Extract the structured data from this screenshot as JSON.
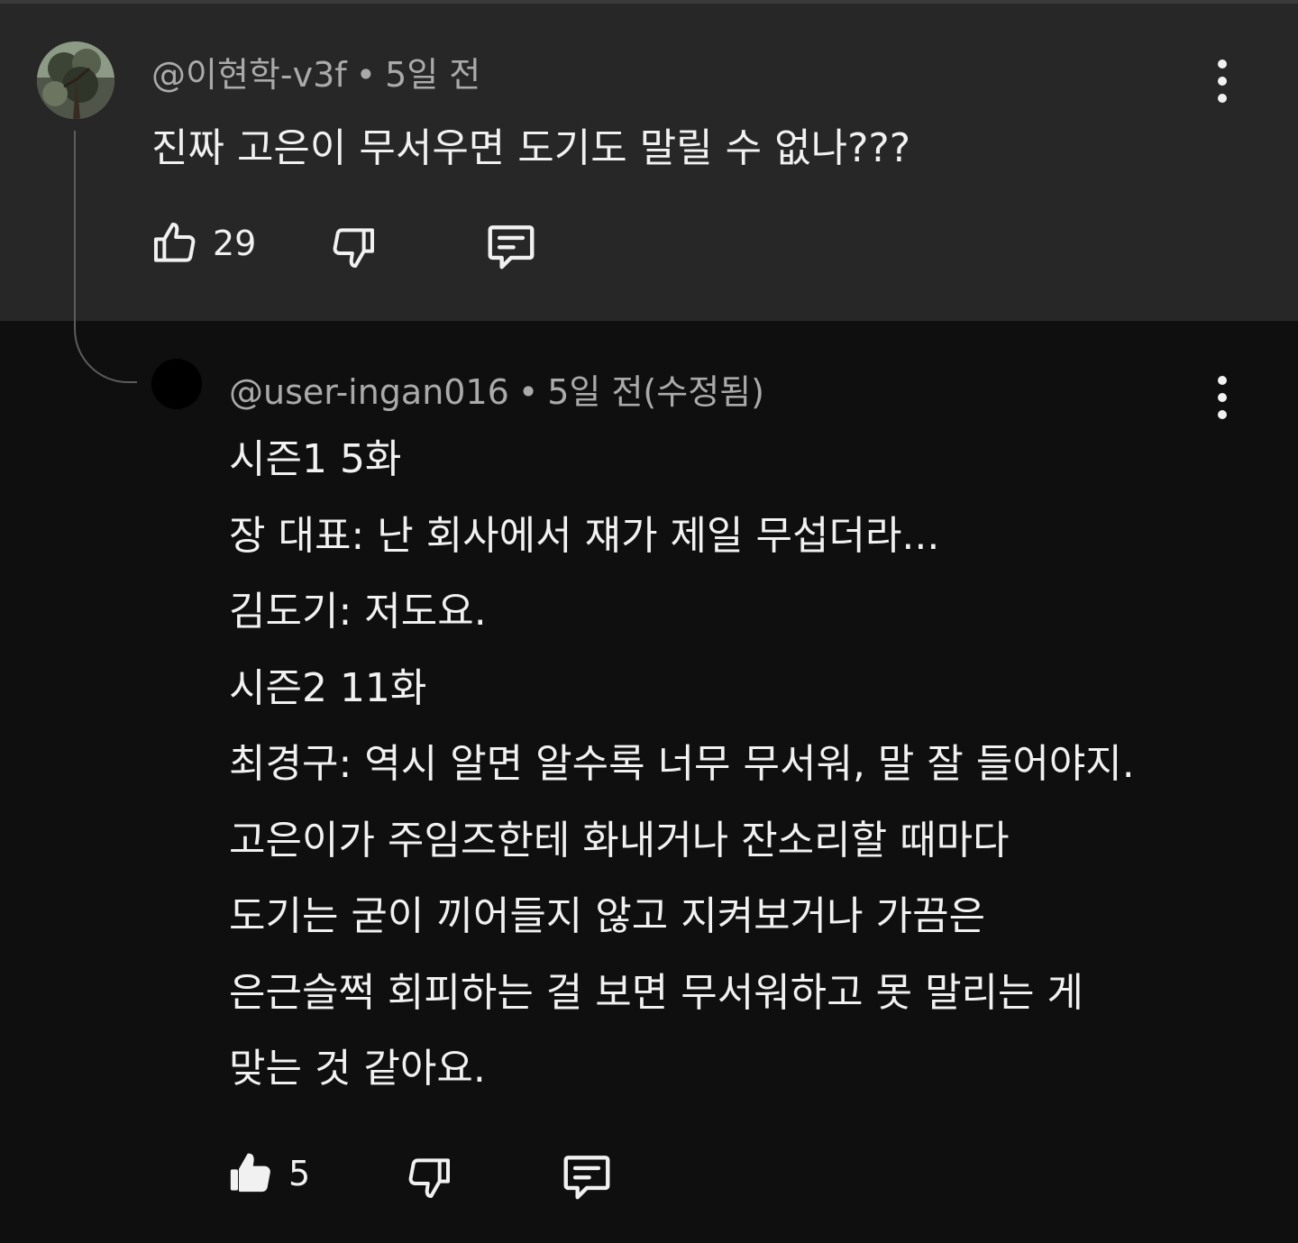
{
  "parent_comment": {
    "author": "@이현학-v3f",
    "separator": "•",
    "time": "5일 전",
    "text": "진짜 고은이 무서우면 도기도 말릴 수 없나???",
    "like_count": "29",
    "icons": {
      "like": "thumbs-up-outline-icon",
      "dislike": "thumbs-down-outline-icon",
      "reply": "reply-comment-icon",
      "menu": "more-vert-icon"
    }
  },
  "reply_comment": {
    "author": "@user-ingan016",
    "separator": "•",
    "time": "5일 전(수정됨)",
    "lines": [
      "시즌1 5화",
      "장 대표: 난 회사에서 쟤가 제일 무섭더라...",
      "김도기: 저도요.",
      "시즌2 11화",
      "최경구: 역시 알면 알수록 너무 무서워, 말 잘 들어야지.",
      "고은이가 주임즈한테 화내거나 잔소리할 때마다",
      "도기는 굳이 끼어들지 않고 지켜보거나 가끔은",
      "은근슬쩍 회피하는 걸 보면 무서워하고 못 말리는 게",
      "맞는 것 같아요."
    ],
    "like_count": "5",
    "liked": true,
    "icons": {
      "like": "thumbs-up-filled-icon",
      "dislike": "thumbs-down-outline-icon",
      "reply": "reply-comment-icon",
      "menu": "more-vert-icon"
    }
  },
  "colors": {
    "parent_background": "#272727",
    "page_background": "#0f0f0f",
    "primary_text": "#f1f1f1",
    "secondary_text": "#aaaaaa",
    "thread_line": "#5c5c5c"
  }
}
